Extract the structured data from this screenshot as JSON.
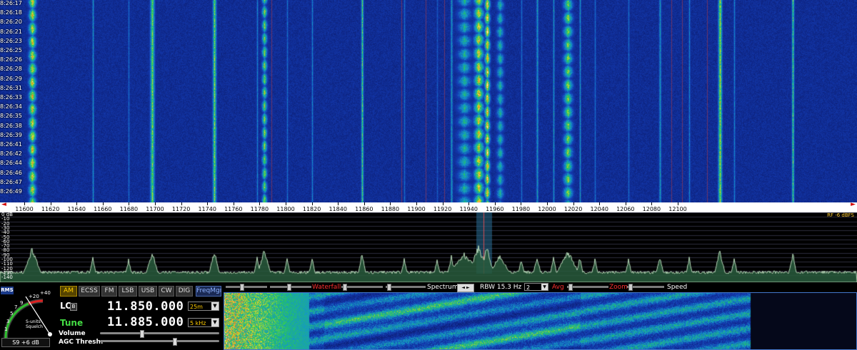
{
  "waterfall": {
    "timestamps": [
      "8:26:17",
      "8:26:18",
      "8:26:20",
      "8:26:21",
      "8:26:23",
      "8:26:25",
      "8:26:26",
      "8:26:28",
      "8:26:29",
      "8:26:31",
      "8:26:33",
      "8:26:34",
      "8:26:35",
      "8:26:38",
      "8:26:39",
      "8:26:41",
      "8:26:42",
      "8:26:44",
      "8:26:46",
      "8:26:47",
      "8:26:49"
    ]
  },
  "frequency_scale": {
    "labels": [
      "11600",
      "11620",
      "11640",
      "11660",
      "11680",
      "11700",
      "11720",
      "11740",
      "11760",
      "11780",
      "11800",
      "11820",
      "11840",
      "11860",
      "11880",
      "11900",
      "11920",
      "11940",
      "11960",
      "11980",
      "12000",
      "12020",
      "12040",
      "12060",
      "12080",
      "12100"
    ],
    "left_arrow": "◄",
    "right_arrow": "►"
  },
  "spectrum": {
    "db_labels": [
      "0 dB",
      "-10",
      "-20",
      "-30",
      "-40",
      "-50",
      "-60",
      "-70",
      "-80",
      "-90",
      "-100",
      "-110",
      "-120",
      "-130",
      "-140"
    ],
    "rf_label": "RF  -6 dBFS"
  },
  "meter": {
    "rms_label": "RMS",
    "scale_labels": [
      "+40",
      "+20",
      "9",
      "7",
      "5",
      "3",
      "1"
    ],
    "s_units_label": "S-units",
    "squelch_label": "Squelch",
    "readout": "S9 +6 dB"
  },
  "modes": [
    {
      "label": "AM",
      "active": true
    },
    {
      "label": "ECSS",
      "active": false
    },
    {
      "label": "FM",
      "active": false
    },
    {
      "label": "LSB",
      "active": false
    },
    {
      "label": "USB",
      "active": false
    },
    {
      "label": "CW",
      "active": false
    },
    {
      "label": "DIG",
      "active": false
    }
  ],
  "freqmgr_label": "FreqMgr",
  "lo": {
    "label": "LO",
    "badge": "B",
    "frequency": "11.850.000",
    "band": "25m"
  },
  "tune": {
    "label": "Tune",
    "frequency": "11.885.000",
    "step": "5 kHz"
  },
  "sliders": {
    "volume_label": "Volume",
    "volume_level": 0.35,
    "agc_label": "AGC Thresh.",
    "agc_level": 0.62
  },
  "control_bar": {
    "waterfall_label": "Waterfall",
    "spectrum_label": "Spectrum",
    "spin_left": "◄",
    "spin_right": "►",
    "rbw_label": "RBW 15.3 Hz",
    "avg_value": "2",
    "avg_label": "Avg",
    "zoom_label": "Zoom",
    "speed_label": "Speed"
  },
  "colors": {
    "waterfall_bg": "#0a1a6e",
    "lo_label": "#ffffff",
    "tune_label": "#44dd44",
    "active_mode": "#ffcc00",
    "red_label": "#ff3030"
  }
}
